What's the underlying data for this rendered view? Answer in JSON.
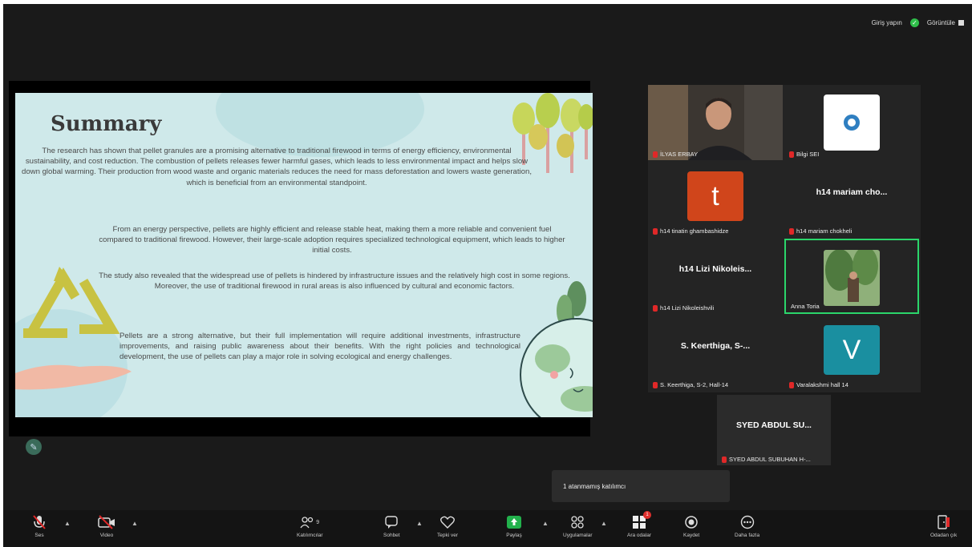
{
  "topbar": {
    "login_label": "Giriş yapın",
    "view_label": "Görüntüle"
  },
  "slide": {
    "title": "Summary",
    "paragraph1": "The research has shown that pellet granules are a promising alternative to traditional firewood in terms of energy efficiency, environmental sustainability, and cost reduction. The combustion of pellets releases fewer harmful gases, which leads to less environmental impact and helps slow down global warming. Their production from wood waste and organic materials reduces the need for mass deforestation and lowers waste generation, which is beneficial from an environmental standpoint.",
    "paragraph2": "From an energy perspective, pellets are highly efficient and release stable heat, making them a more reliable and convenient fuel compared to traditional firewood. However, their large-scale adoption requires specialized technological equipment, which leads to higher initial costs.",
    "paragraph3": "The study also revealed that the widespread use of pellets is hindered by infrastructure issues and the relatively high cost in some regions. Moreover, the use of traditional firewood in rural areas is also influenced by cultural and economic factors.",
    "paragraph4": "Pellets are a strong alternative, but their full implementation will require additional investments, infrastructure improvements, and raising public awareness about their benefits. With the right policies and technological development, the use of pellets can play a major role in solving ecological and energy challenges."
  },
  "participants": [
    {
      "name": "İLYAS ERBAY",
      "display": "",
      "avatar": "video"
    },
    {
      "name": "Bilgi SEI",
      "display": "",
      "avatar": "logo"
    },
    {
      "name": "h14 tinatin ghambashidze",
      "display": "t",
      "avatar": "letter",
      "color": "#d0451b"
    },
    {
      "name": "h14 mariam chokheli",
      "display": "h14 mariam cho...",
      "avatar": "text"
    },
    {
      "name": "h14 Lizi Nikoleishvili",
      "display": "h14 Lizi Nikoleis...",
      "avatar": "text"
    },
    {
      "name": "Anna Toria",
      "display": "",
      "avatar": "photo"
    },
    {
      "name": "S. Keerthiga, S-2, Hall-14",
      "display": "S. Keerthiga, S-...",
      "avatar": "text"
    },
    {
      "name": "Varalakshmi hall 14",
      "display": "V",
      "avatar": "letter",
      "color": "#1a8fa0"
    },
    {
      "name": "SYED ABDUL SUBUHAN H-...",
      "display": "SYED ABDUL SU...",
      "avatar": "text"
    }
  ],
  "notification": "1 atanmamış katılımcı",
  "toolbar": {
    "audio": "Ses",
    "video": "Video",
    "participants": "Katılımcılar",
    "participants_count": "9",
    "chat": "Sohbet",
    "react": "Tepki ver",
    "share": "Paylaş",
    "apps": "Uygulamalar",
    "breakout": "Ara odalar",
    "breakout_badge": "1",
    "record": "Kaydet",
    "more": "Daha fazla",
    "leave": "Odadan çık"
  },
  "colors": {
    "background": "#1a1a1a",
    "share_green": "#22b14c",
    "active_border": "#2bd66b",
    "mic_off": "#e02828"
  }
}
